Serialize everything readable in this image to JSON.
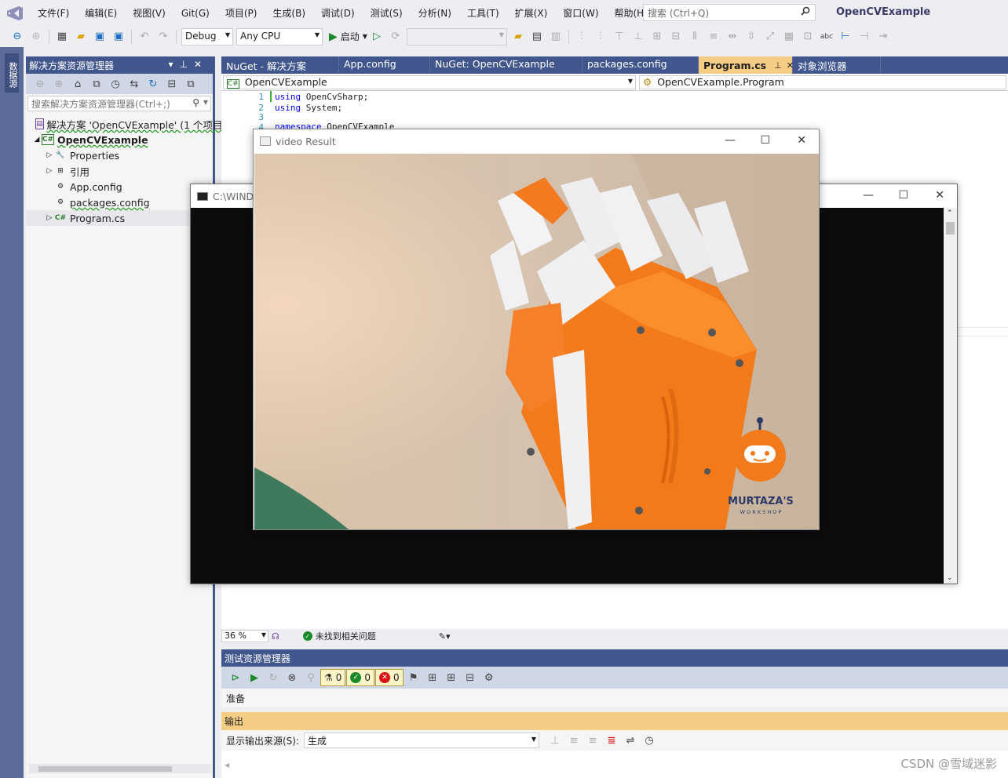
{
  "menubar": {
    "items": [
      "文件(F)",
      "编辑(E)",
      "视图(V)",
      "Git(G)",
      "项目(P)",
      "生成(B)",
      "调试(D)",
      "测试(S)",
      "分析(N)",
      "工具(T)",
      "扩展(X)",
      "窗口(W)",
      "帮助(H)"
    ],
    "search_placeholder": "搜索 (Ctrl+Q)",
    "app_title": "OpenCVExample"
  },
  "toolbar": {
    "config": "Debug",
    "platform": "Any CPU",
    "start_label": "启动"
  },
  "leftstrip": {
    "tab_label": "数据源"
  },
  "solution_explorer": {
    "title": "解决方案资源管理器",
    "search_placeholder": "搜索解决方案资源管理器(Ctrl+;)",
    "solution_label": "解决方案 'OpenCVExample' (1 个项目",
    "project_label": "OpenCVExample",
    "items": [
      "Properties",
      "引用",
      "App.config",
      "packages.config",
      "Program.cs"
    ]
  },
  "editor": {
    "tabs": [
      "NuGet - 解决方案",
      "App.config",
      "NuGet: OpenCVExample",
      "packages.config",
      "Program.cs",
      "对象浏览器"
    ],
    "active_tab": "Program.cs",
    "nav_left": "OpenCVExample",
    "nav_right": "OpenCVExample.Program",
    "lines": [
      {
        "n": "1",
        "kw": "using",
        "rest": " OpenCvSharp;"
      },
      {
        "n": "2",
        "kw": "using",
        "rest": " System;"
      },
      {
        "n": "3",
        "kw": "",
        "rest": ""
      },
      {
        "n": "4",
        "kw": "namespace",
        "rest": " OpenCVExample"
      }
    ],
    "zoom": "36 %",
    "issues": "未找到相关问题"
  },
  "test_explorer": {
    "title": "测试资源管理器",
    "counts": {
      "total": "0",
      "passed": "0",
      "failed": "0"
    },
    "status": "准备"
  },
  "output": {
    "title": "输出",
    "source_label": "显示输出来源(S):",
    "source_value": "生成"
  },
  "console": {
    "title": "C:\\WIND"
  },
  "video_window": {
    "title": "video Result",
    "logo_name": "MURTAZA'S",
    "logo_sub": "W O R K S H O P"
  },
  "watermark": "CSDN @雪域迷影",
  "colors": {
    "accent_blue": "#40568d",
    "active_tab": "#f5cc84",
    "menu_bg": "#eeeef2"
  }
}
